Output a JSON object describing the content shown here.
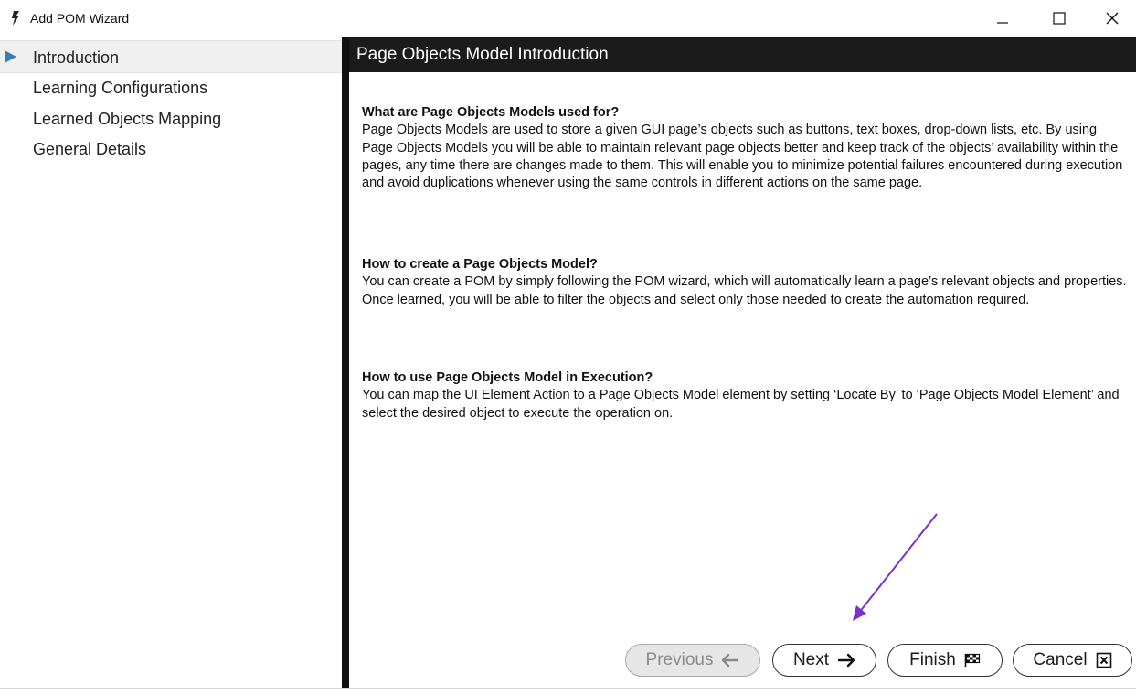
{
  "window": {
    "title": "Add POM Wizard",
    "minimize_icon": "minimize-icon",
    "maximize_icon": "maximize-icon",
    "close_icon": "close-icon"
  },
  "sidebar": {
    "items": [
      {
        "label": "Introduction",
        "active": true
      },
      {
        "label": "Learning Configurations",
        "active": false
      },
      {
        "label": "Learned Objects Mapping",
        "active": false
      },
      {
        "label": "General Details",
        "active": false
      }
    ]
  },
  "page": {
    "title": "Page Objects Model Introduction",
    "sections": [
      {
        "title": "What are Page Objects Models used for?",
        "body": "Page Objects Models are used to store a given GUI page’s objects such as buttons, text boxes, drop-down lists, etc. By using Page Objects Models you will be able to maintain relevant page objects better and keep track of the objects’ availability within the pages, any time there are changes made to them. This will enable you to minimize potential failures encountered during execution and avoid duplications whenever using the same controls in different actions on the same page."
      },
      {
        "title": "How to create a Page Objects Model?",
        "body": "You can create a POM by simply following the POM wizard, which will automatically learn a page’s relevant objects and properties. Once learned, you will be able to filter the objects and select only those needed to create the automation required."
      },
      {
        "title": "How to use Page Objects Model in Execution?",
        "body": "You can map the UI Element Action to a Page Objects Model element by setting  ‘Locate By’ to ‘Page Objects Model Element’ and select the desired object to execute the operation on."
      }
    ]
  },
  "footer": {
    "previous_label": "Previous",
    "previous_enabled": false,
    "next_label": "Next",
    "finish_label": "Finish",
    "cancel_label": "Cancel"
  },
  "colors": {
    "header_bg": "#1b1b1b",
    "nav_arrow": "#3b7ab8",
    "annotation_arrow": "#7b2fd0"
  }
}
